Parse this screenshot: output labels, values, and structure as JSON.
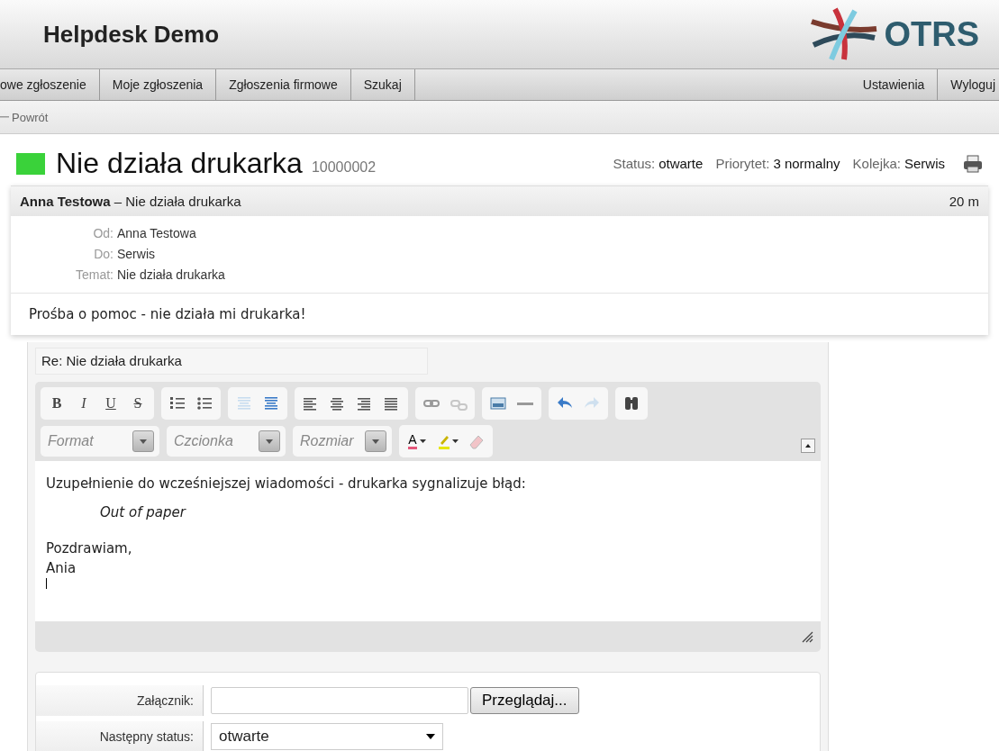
{
  "header": {
    "title": "Helpdesk Demo",
    "logo_text": "OTRS"
  },
  "nav": {
    "left": [
      {
        "label": "owe zgłoszenie"
      },
      {
        "label": "Moje zgłoszenia"
      },
      {
        "label": "Zgłoszenia firmowe"
      },
      {
        "label": "Szukaj"
      }
    ],
    "right": [
      {
        "label": "Ustawienia"
      },
      {
        "label": "Wyloguj"
      }
    ]
  },
  "back_link": "Powrót",
  "ticket": {
    "title": "Nie działa drukarka",
    "number": "10000002",
    "meta": [
      {
        "label": "Status:",
        "value": "otwarte"
      },
      {
        "label": "Priorytet:",
        "value": "3 normalny"
      },
      {
        "label": "Kolejka:",
        "value": "Serwis"
      }
    ]
  },
  "article": {
    "heading": "**Anna Testowa** – Nie działa drukarka",
    "age": "20 m",
    "fields": [
      {
        "label": "Od:",
        "value": "Anna Testowa"
      },
      {
        "label": "Do:",
        "value": "Serwis"
      },
      {
        "label": "Temat:",
        "value": "Nie działa drukarka"
      }
    ],
    "body": "Prośba o pomoc - nie działa mi drukarka!"
  },
  "reply": {
    "subject": "Re: Nie działa drukarka",
    "style_buttons": [
      "B",
      "I",
      "U",
      "S"
    ],
    "combos": [
      {
        "placeholder": "Format"
      },
      {
        "placeholder": "Czcionka"
      },
      {
        "placeholder": "Rozmiar"
      }
    ],
    "text_color_letter": "A",
    "lines": [
      {
        "kind": "text",
        "text": "Uzupełnienie do wcześniejszej wiadomości - drukarka sygnalizuje błąd:"
      },
      {
        "kind": "quote",
        "text": "Out of paper"
      },
      {
        "kind": "blank"
      },
      {
        "kind": "text",
        "text": "Pozdrawiam,"
      },
      {
        "kind": "text",
        "text": "Ania"
      }
    ]
  },
  "form": [
    {
      "kind": "file",
      "label": "Załącznik:",
      "button": "Przeglądaj..."
    },
    {
      "kind": "select",
      "label": "Następny status:",
      "value": "otwarte"
    }
  ]
}
